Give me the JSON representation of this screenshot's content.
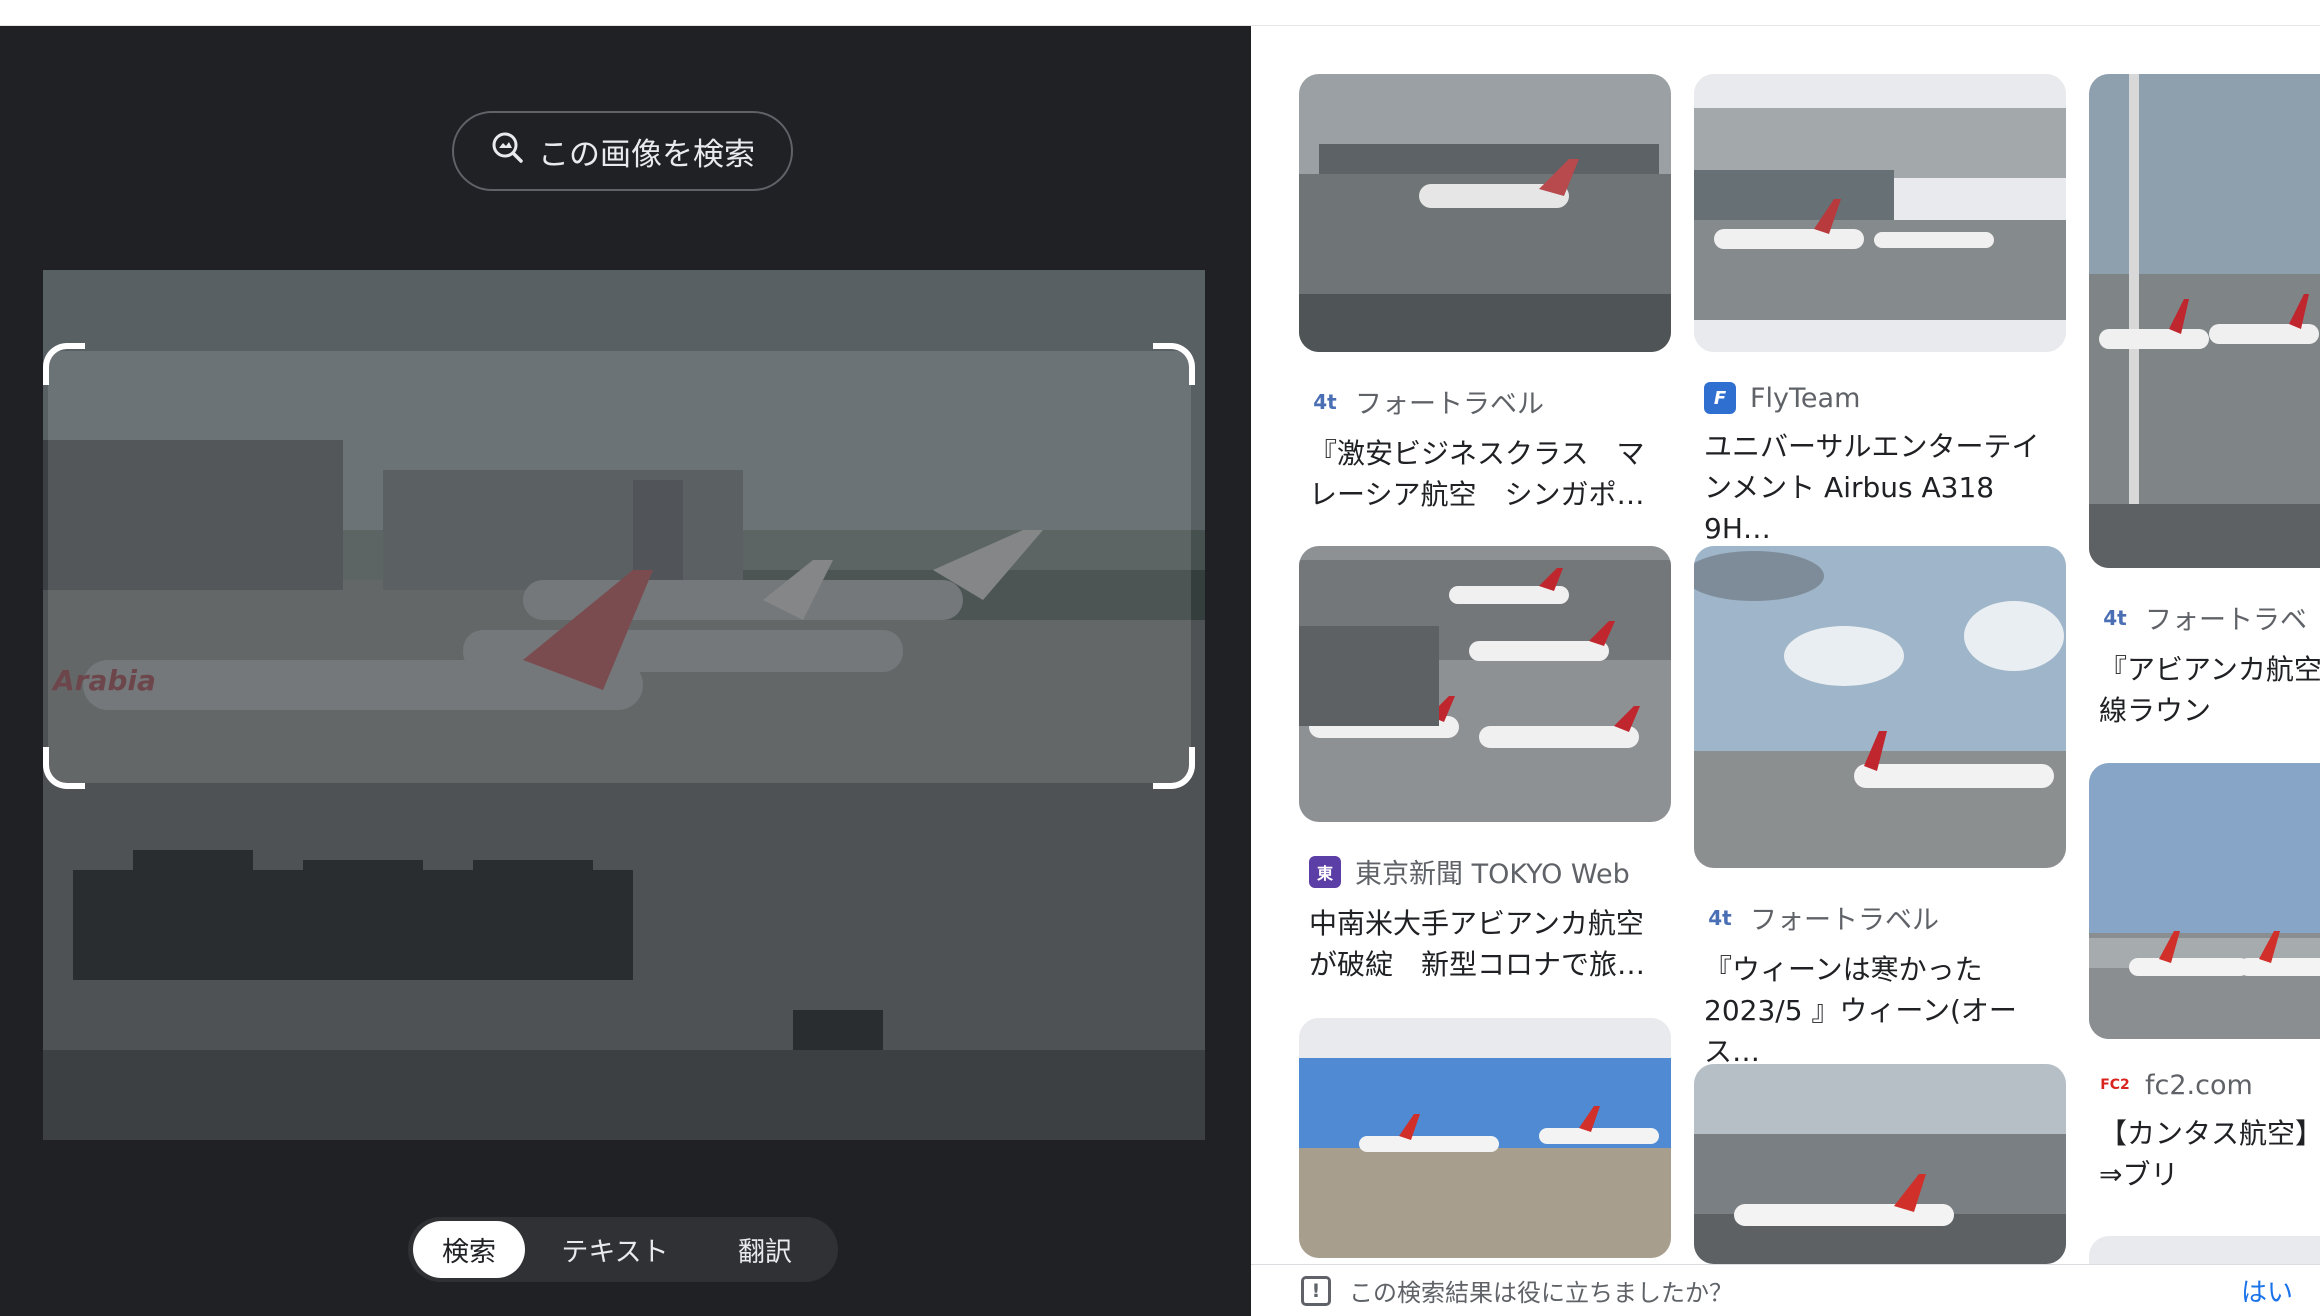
{
  "lens": {
    "search_image_label": "この画像を検索",
    "search_image_icon": "image-search-icon",
    "modes": [
      "検索",
      "テキスト",
      "翻訳"
    ],
    "active_mode": "検索"
  },
  "results": [
    {
      "source": "フォートラベル",
      "favicon": "4travel-favicon",
      "title": "『激安ビジネスクラス　マレーシア航空　シンガポ…"
    },
    {
      "source": "FlyTeam",
      "favicon": "flyteam-favicon",
      "title": "ユニバーサルエンターテインメント Airbus A318 9H…"
    },
    {
      "source": "フォートラベ",
      "favicon": "4travel-favicon",
      "title": "『アビアンカ航空空港国内線ラウン"
    },
    {
      "source": "東京新聞 TOKYO Web",
      "favicon": "tokyo-shimbun-favicon",
      "title": "中南米大手アビアンカ航空が破綻　新型コロナで旅…"
    },
    {
      "source": "フォートラベル",
      "favicon": "4travel-favicon",
      "title": "『ウィーンは寒かった 2023/5 』ウィーン(オース…"
    },
    {
      "source": "fc2.com",
      "favicon": "fc2-favicon",
      "title": "【カンタス航空】⇒シドニー⇒ブリ"
    }
  ],
  "favicon_text": {
    "ft": "4t",
    "fly": "F",
    "tokyo": "東",
    "fc2": "FC2"
  },
  "photo_text": {
    "livery": "Arabia"
  },
  "footer": {
    "question": "この検索結果は役に立ちましたか？",
    "yes": "はい"
  },
  "colors": {
    "panel_bg": "#202124",
    "accent_link": "#1a73e8"
  }
}
